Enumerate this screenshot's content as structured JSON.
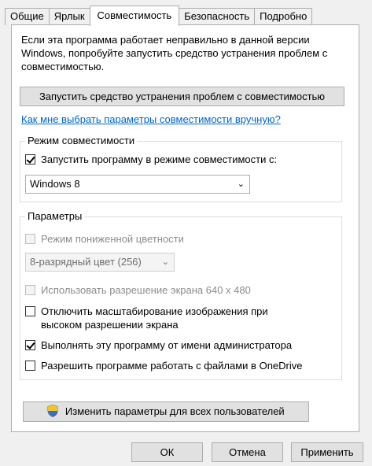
{
  "tabs": [
    {
      "label": "Общие"
    },
    {
      "label": "Ярлык"
    },
    {
      "label": "Совместимость"
    },
    {
      "label": "Безопасность"
    },
    {
      "label": "Подробно"
    }
  ],
  "intro_text": "Если эта программа работает неправильно в данной версии Windows, попробуйте запустить средство устранения проблем с совместимостью.",
  "troubleshooter_button": "Запустить средство устранения проблем с совместимостью",
  "manual_link": "Как мне выбрать параметры совместимости вручную?",
  "compat_mode": {
    "title": "Режим совместимости",
    "checkbox_label": "Запустить программу в режиме совместимости с:",
    "checked": true,
    "selected_os": "Windows 8"
  },
  "settings": {
    "title": "Параметры",
    "reduced_color_label": "Режим пониженной цветности",
    "color_depth_value": "8-разрядный цвет (256)",
    "resolution_640_label": "Использовать разрешение экрана 640 x 480",
    "disable_scaling_label": "Отключить масштабирование изображения при высоком разрешении экрана",
    "run_as_admin_label": "Выполнять эту программу от имени администратора",
    "onedrive_label": "Разрешить программе работать с файлами в OneDrive"
  },
  "all_users_button": "Изменить параметры для всех пользователей",
  "dialog_buttons": {
    "ok": "ОК",
    "cancel": "Отмена",
    "apply": "Применить"
  }
}
